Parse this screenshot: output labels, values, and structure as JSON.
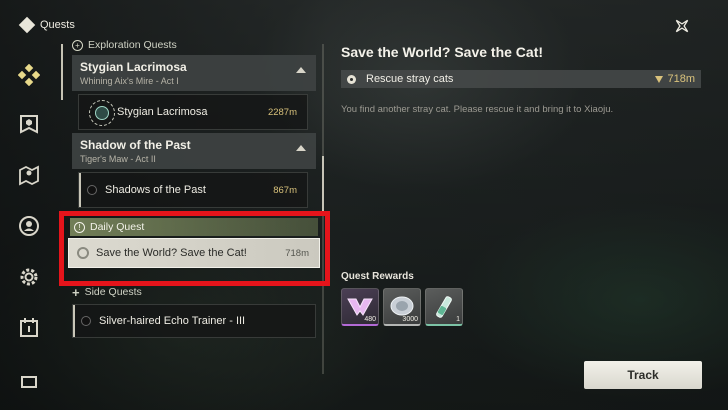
{
  "header": {
    "title": "Quests",
    "close_icon": "close-sparkle-icon"
  },
  "sidebar": {
    "items": [
      {
        "icon": "quest-diamond-icon",
        "active": true
      },
      {
        "icon": "bookmark-shield-icon",
        "active": false
      },
      {
        "icon": "map-pin-icon",
        "active": false
      },
      {
        "icon": "compass-circle-icon",
        "active": false
      },
      {
        "icon": "gear-circle-icon",
        "active": false
      },
      {
        "icon": "calendar-icon",
        "active": false
      },
      {
        "icon": "more-icon",
        "active": false
      }
    ]
  },
  "quest_list": {
    "exploration_header": "Exploration Quests",
    "chapters": [
      {
        "name": "Stygian Lacrimosa",
        "sub": "Whining Aix's Mire - Act I",
        "quest": "Stygian Lacrimosa",
        "distance": "2287m"
      },
      {
        "name": "Shadow of the Past",
        "sub": "Tiger's Maw - Act II",
        "quest": "Shadows of the Past",
        "distance": "867m"
      }
    ],
    "daily_header": "Daily Quest",
    "daily_quest": {
      "name": "Save the World? Save the Cat!",
      "distance": "718m"
    },
    "side_header": "Side Quests",
    "side_quest": {
      "name": "Silver-haired Echo Trainer - III"
    }
  },
  "detail": {
    "title": "Save the World? Save the Cat!",
    "objective": "Rescue stray cats",
    "objective_distance": "718m",
    "description": "You find another stray cat. Please rescue it and bring it to Xiaoju."
  },
  "rewards": {
    "label": "Quest Rewards",
    "items": [
      {
        "icon": "astrite-icon",
        "count": "480"
      },
      {
        "icon": "shell-credit-icon",
        "count": "3000"
      },
      {
        "icon": "potion-tube-icon",
        "count": "1"
      }
    ]
  },
  "actions": {
    "track_label": "Track"
  },
  "colors": {
    "highlight": "#e5141b",
    "distance": "#d9c27c",
    "daily_accent": "#b9cf84"
  }
}
